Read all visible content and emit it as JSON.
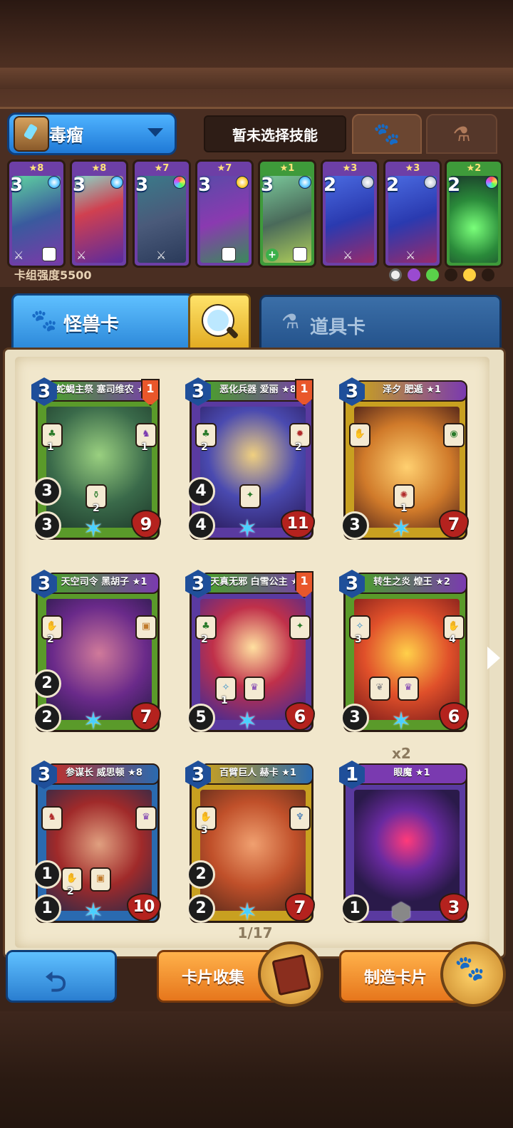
{
  "deck": {
    "name": "毒瘤",
    "skill_placeholder": "暂未选择技能",
    "power_label": "卡组强度5500"
  },
  "deck_cards": [
    {
      "stars": "★8",
      "cost": "3"
    },
    {
      "stars": "★8",
      "cost": "3"
    },
    {
      "stars": "★7",
      "cost": "3"
    },
    {
      "stars": "★7",
      "cost": "3"
    },
    {
      "stars": "★1",
      "cost": "3"
    },
    {
      "stars": "★3",
      "cost": "2"
    },
    {
      "stars": "★3",
      "cost": "2"
    },
    {
      "stars": "★2",
      "cost": "2"
    }
  ],
  "tabs": {
    "monster": "怪兽卡",
    "item": "道具卡"
  },
  "cards": [
    {
      "cost": "3",
      "name": "蛇蝎主祭 塞司维农 ★1",
      "flag": "1",
      "s1": "1",
      "s2": "1",
      "s3": "2",
      "b1": "3",
      "b2": "3",
      "hp": "9"
    },
    {
      "cost": "3",
      "name": "恶化兵器 爱丽 ★8",
      "flag": "1",
      "s1": "2",
      "s2": "2",
      "s3": "",
      "b1": "4",
      "b2": "4",
      "hp": "11"
    },
    {
      "cost": "3",
      "name": "泽夕 肥遁 ★1",
      "flag": "",
      "s1": "",
      "s2": "",
      "s3": "1",
      "b1": "",
      "b2": "3",
      "hp": "7"
    },
    {
      "cost": "3",
      "name": "天空司令 黑胡子 ★1",
      "flag": "",
      "s1": "2",
      "s2": "",
      "s3": "",
      "b1": "2",
      "b2": "2",
      "hp": "7"
    },
    {
      "cost": "3",
      "name": "天真无邪 白雪公主 ★8",
      "flag": "1",
      "s1": "2",
      "s2": "",
      "s3": "1",
      "b1": "",
      "b2": "5",
      "hp": "6"
    },
    {
      "cost": "3",
      "name": "转生之炎 煌王 ★2",
      "flag": "",
      "s1": "3",
      "s2": "4",
      "s3": "",
      "b1": "",
      "b2": "3",
      "hp": "6"
    },
    {
      "cost": "3",
      "name": "参谋长 威思顿 ★8",
      "flag": "",
      "s1": "",
      "s2": "",
      "s3": "2",
      "b1": "1",
      "b2": "1",
      "hp": "10"
    },
    {
      "cost": "3",
      "name": "百臂巨人 赫卡 ★1",
      "flag": "",
      "s1": "3",
      "s2": "",
      "s3": "",
      "b1": "2",
      "b2": "2",
      "hp": "7"
    },
    {
      "cost": "1",
      "name": "眼魔 ★1",
      "flag": "",
      "s1": "",
      "s2": "",
      "s3": "",
      "b1": "",
      "b2": "1",
      "hp": "3",
      "count": "x2"
    }
  ],
  "pager": "1/17",
  "buttons": {
    "collect": "卡片收集",
    "craft": "制造卡片"
  },
  "colors": {
    "blue": "#2a86d8",
    "orange": "#e6761c",
    "parchment": "#f1e7cc",
    "wood": "#4a2e22"
  }
}
